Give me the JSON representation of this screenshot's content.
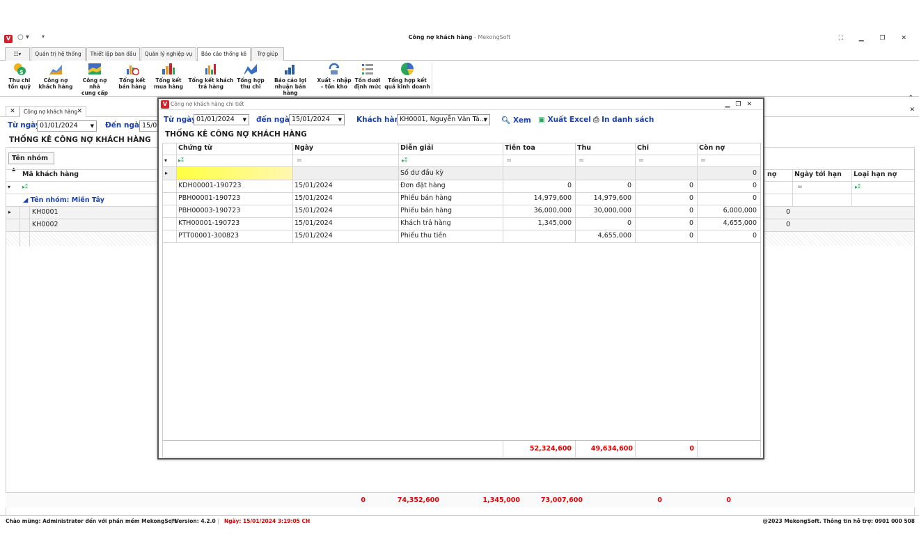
{
  "window": {
    "title": "Công nợ khách hàng",
    "app_name": "MekongSoft",
    "title_sep": " - "
  },
  "menu_tabs": [
    "Quản trị hệ thống",
    "Thiết lập ban đầu",
    "Quản lý nghiệp vụ",
    "Báo cáo thống kê",
    "Trợ giúp"
  ],
  "ribbon": [
    {
      "l1": "Thu chi",
      "l2": "tồn quỹ"
    },
    {
      "l1": "Công nợ",
      "l2": "khách hàng"
    },
    {
      "l1": "Công nợ nhà",
      "l2": "cung cấp"
    },
    {
      "l1": "Tổng kết",
      "l2": "bán hàng"
    },
    {
      "l1": "Tổng kết",
      "l2": "mua hàng"
    },
    {
      "l1": "Tổng kết khách",
      "l2": "trả hàng"
    },
    {
      "l1": "Tổng hợp",
      "l2": "thu chi"
    },
    {
      "l1": "Báo cáo lợi",
      "l2": "nhuận bán hàng"
    },
    {
      "l1": "Xuất - nhập",
      "l2": "- tồn kho"
    },
    {
      "l1": "Tồn dưới",
      "l2": "định mức"
    },
    {
      "l1": "Tổng hợp kết",
      "l2": "quả kinh doanh"
    }
  ],
  "doc_tab": {
    "label": "Công nợ khách hàng"
  },
  "main": {
    "from_label": "Từ ngày",
    "from_value": "01/01/2024",
    "to_label": "Đến ngày",
    "to_value": "15/0",
    "section_title": "THỐNG KÊ CÔNG NỢ KHÁCH HÀNG",
    "group_chip": "Tên nhóm",
    "col_code": "Mã khách hàng",
    "col_debt_tail": "nợ",
    "col_due": "Ngày tới hạn",
    "col_type": "Loại hạn nợ",
    "group_label": "Tên nhóm: Miền Tây",
    "rows": [
      {
        "code": "KH0001",
        "tail": "0"
      },
      {
        "code": "KH0002",
        "tail": "0"
      }
    ],
    "totals": [
      "0",
      "74,352,600",
      "1,345,000",
      "73,007,600",
      "0",
      "0"
    ]
  },
  "dialog": {
    "title": "Công nợ khách hàng chi tiết",
    "from_label": "Từ ngày",
    "from_value": "01/01/2024",
    "to_label": "đến ngày",
    "to_value": "15/01/2024",
    "cust_label": "Khách hàng",
    "cust_value": "KH0001, Nguyễn Văn Tá...",
    "view_btn": "Xem",
    "excel_btn": "Xuất Excel",
    "print_btn": "In danh sách",
    "section_title": "THỐNG KÊ CÔNG NỢ KHÁCH HÀNG",
    "headers": [
      "Chứng từ",
      "Ngày",
      "Diễn giải",
      "Tiền toa",
      "Thu",
      "Chi",
      "Còn nợ"
    ],
    "opening": {
      "desc": "Số dư đầu kỳ",
      "balance": "0"
    },
    "rows": [
      [
        "KDH00001-190723",
        "15/01/2024",
        "Đơn đặt hàng",
        "0",
        "0",
        "0",
        "0"
      ],
      [
        "PBH00001-190723",
        "15/01/2024",
        "Phiếu bán hàng",
        "14,979,600",
        "14,979,600",
        "0",
        "0"
      ],
      [
        "PBH00003-190723",
        "15/01/2024",
        "Phiếu bán hàng",
        "36,000,000",
        "30,000,000",
        "0",
        "6,000,000"
      ],
      [
        "KTH00001-190723",
        "15/01/2024",
        "Khách trả hàng",
        "1,345,000",
        "0",
        "0",
        "4,655,000"
      ],
      [
        "PTT00001-300823",
        "15/01/2024",
        "Phiếu thu tiền",
        "",
        "4,655,000",
        "0",
        "0"
      ]
    ],
    "totals": {
      "tien_toa": "52,324,600",
      "thu": "49,634,600",
      "chi": "0"
    }
  },
  "status": {
    "welcome": "Chào mừng: Administrator đến với phần mềm MekongSoft",
    "version": "Version: 4.2.0",
    "date": "Ngày: 15/01/2024 3:19:05 CH",
    "copyright": "@2023 MekongSoft. Thông tin hỗ trợ: 0901 000 508"
  },
  "colors": {
    "accent_blue": "#1a3fb0",
    "total_red": "#e00000",
    "brand_red": "#d0202a",
    "highlight_yellow": "#ffff40"
  }
}
